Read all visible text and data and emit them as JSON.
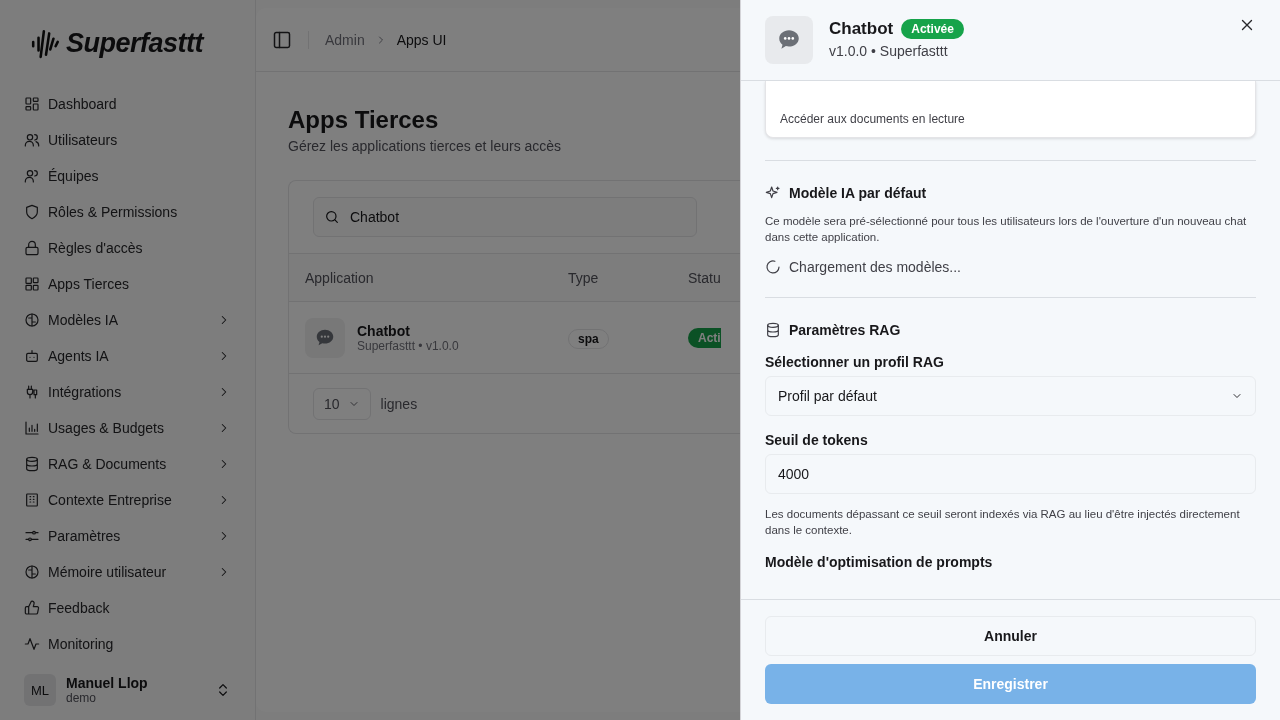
{
  "brand": "Superfasttt",
  "sidebar": {
    "items": [
      {
        "label": "Dashboard",
        "expandable": false
      },
      {
        "label": "Utilisateurs",
        "expandable": false
      },
      {
        "label": "Équipes",
        "expandable": false
      },
      {
        "label": "Rôles & Permissions",
        "expandable": false
      },
      {
        "label": "Règles d'accès",
        "expandable": false
      },
      {
        "label": "Apps Tierces",
        "expandable": false
      },
      {
        "label": "Modèles IA",
        "expandable": true
      },
      {
        "label": "Agents IA",
        "expandable": true
      },
      {
        "label": "Intégrations",
        "expandable": true
      },
      {
        "label": "Usages & Budgets",
        "expandable": true
      },
      {
        "label": "RAG & Documents",
        "expandable": true
      },
      {
        "label": "Contexte Entreprise",
        "expandable": true
      },
      {
        "label": "Paramètres",
        "expandable": true
      },
      {
        "label": "Mémoire utilisateur",
        "expandable": true
      },
      {
        "label": "Feedback",
        "expandable": false
      },
      {
        "label": "Monitoring",
        "expandable": false
      }
    ],
    "user": {
      "initials": "ML",
      "name": "Manuel Llop",
      "role": "demo"
    }
  },
  "breadcrumb": [
    "Admin",
    "Apps UI"
  ],
  "page": {
    "title": "Apps Tierces",
    "subtitle": "Gérez les applications tierces et leurs accès",
    "search": {
      "value": "Chatbot"
    },
    "table": {
      "columns": [
        "Application",
        "Type",
        "Statu"
      ],
      "rows": [
        {
          "name": "Chatbot",
          "meta": "Superfasttt • v1.0.0",
          "type": "spa",
          "status": "Acti"
        }
      ]
    },
    "page_size": "10",
    "page_size_label": "lignes"
  },
  "drawer": {
    "title": "Chatbot",
    "badge": "Activée",
    "subtitle": "v1.0.0 • Superfasttt",
    "permission": {
      "description": "Accéder aux documents en lecture"
    },
    "model_section": {
      "title": "Modèle IA par défaut",
      "description": "Ce modèle sera pré-sélectionné pour tous les utilisateurs lors de l'ouverture d'un nouveau chat dans cette application.",
      "loading": "Chargement des modèles..."
    },
    "rag_section": {
      "title": "Paramètres RAG",
      "profile_label": "Sélectionner un profil RAG",
      "profile_value": "Profil par défaut",
      "threshold_label": "Seuil de tokens",
      "threshold_value": "4000",
      "threshold_help": "Les documents dépassant ce seuil seront indexés via RAG au lieu d'être injectés directement dans le contexte.",
      "prompt_model_label": "Modèle d'optimisation de prompts"
    },
    "buttons": [
      {
        "label": "Annuler",
        "kind": "secondary",
        "disabled": false
      },
      {
        "label": "Enregistrer",
        "kind": "primary",
        "disabled": true
      }
    ]
  }
}
